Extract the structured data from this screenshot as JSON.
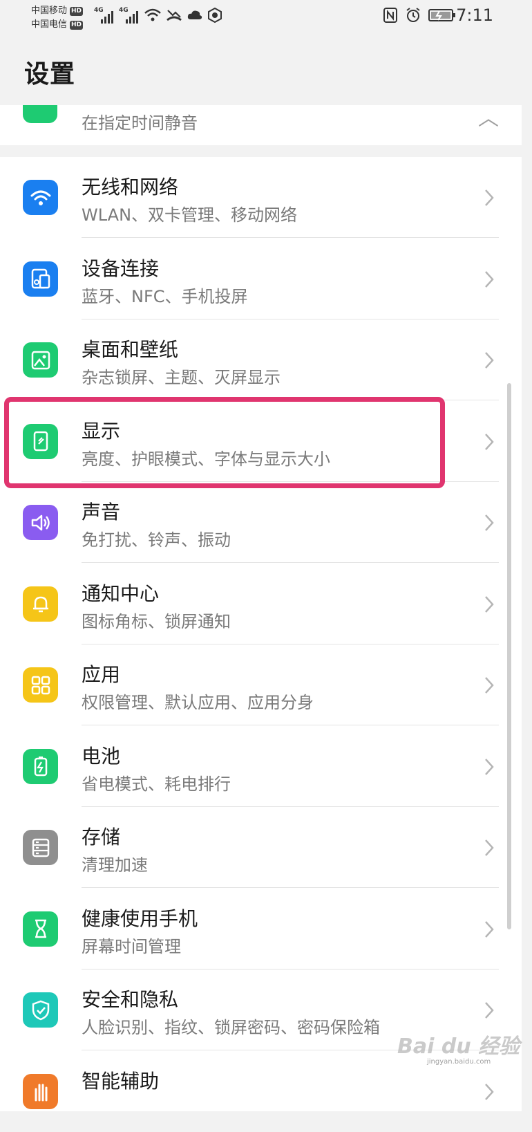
{
  "status_bar": {
    "carrier_1": "中国移动",
    "carrier_2": "中国电信",
    "hd_label": "HD",
    "network_label": "4G",
    "time": "7:11"
  },
  "header": {
    "title": "设置"
  },
  "partial_item": {
    "subtitle": "在指定时间静音",
    "icon": "moon-icon"
  },
  "items": [
    {
      "title": "无线和网络",
      "subtitle": "WLAN、双卡管理、移动网络",
      "icon": "wifi-icon",
      "color": "#1a7ff0"
    },
    {
      "title": "设备连接",
      "subtitle": "蓝牙、NFC、手机投屏",
      "icon": "device-connect-icon",
      "color": "#1a7ff0"
    },
    {
      "title": "桌面和壁纸",
      "subtitle": "杂志锁屏、主题、灭屏显示",
      "icon": "wallpaper-icon",
      "color": "#1ecb72"
    },
    {
      "title": "显示",
      "subtitle": "亮度、护眼模式、字体与显示大小",
      "icon": "display-icon",
      "color": "#1ecb72"
    },
    {
      "title": "声音",
      "subtitle": "免打扰、铃声、振动",
      "icon": "sound-icon",
      "color": "#8a5cf0"
    },
    {
      "title": "通知中心",
      "subtitle": "图标角标、锁屏通知",
      "icon": "bell-icon",
      "color": "#f5c518"
    },
    {
      "title": "应用",
      "subtitle": "权限管理、默认应用、应用分身",
      "icon": "apps-icon",
      "color": "#f5c518"
    },
    {
      "title": "电池",
      "subtitle": "省电模式、耗电排行",
      "icon": "battery-icon",
      "color": "#1ecb72"
    },
    {
      "title": "存储",
      "subtitle": "清理加速",
      "icon": "storage-icon",
      "color": "#8f8f8f"
    },
    {
      "title": "健康使用手机",
      "subtitle": "屏幕时间管理",
      "icon": "hourglass-icon",
      "color": "#1ecb72"
    },
    {
      "title": "安全和隐私",
      "subtitle": "人脸识别、指纹、锁屏密码、密码保险箱",
      "icon": "shield-icon",
      "color": "#1ec8b8"
    },
    {
      "title": "智能辅助",
      "subtitle": "",
      "icon": "hand-icon",
      "color": "#f07a2a"
    }
  ],
  "highlight_color": "#e0356f",
  "watermark": {
    "text": "Baidu经验",
    "sub": "jingyan.baidu.com"
  }
}
